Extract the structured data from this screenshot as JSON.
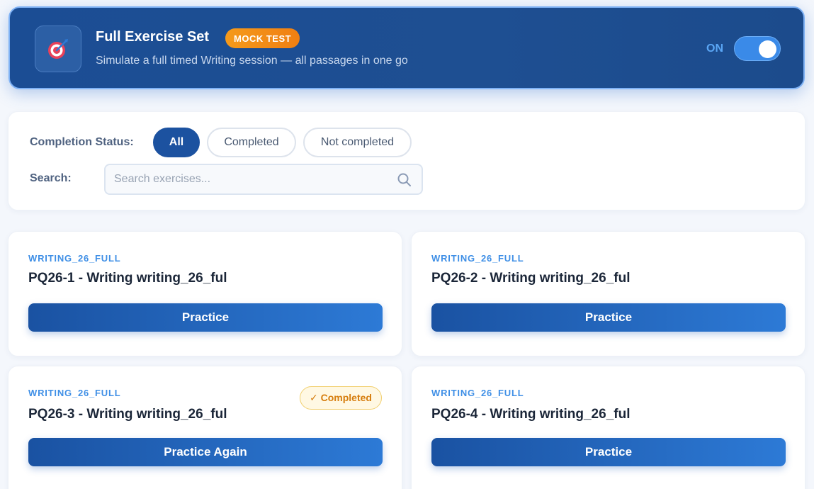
{
  "header": {
    "icon": "target-dart-icon",
    "title": "Full Exercise Set",
    "badge": "MOCK TEST",
    "subtitle": "Simulate a full timed Writing session — all passages in one go",
    "toggle_label": "ON",
    "toggle_on": true
  },
  "filters": {
    "status_label": "Completion Status:",
    "options": [
      "All",
      "Completed",
      "Not completed"
    ],
    "selected": "All",
    "search_label": "Search:",
    "search_placeholder": "Search exercises...",
    "search_value": ""
  },
  "cards": [
    {
      "tag": "WRITING_26_FULL",
      "title": "PQ26-1 - Writing writing_26_ful",
      "button": "Practice",
      "status": ""
    },
    {
      "tag": "WRITING_26_FULL",
      "title": "PQ26-2 - Writing writing_26_ful",
      "button": "Practice",
      "status": ""
    },
    {
      "tag": "WRITING_26_FULL",
      "title": "PQ26-3 - Writing writing_26_ful",
      "button": "Practice Again",
      "status": "✓ Completed"
    },
    {
      "tag": "WRITING_26_FULL",
      "title": "PQ26-4 - Writing writing_26_ful",
      "button": "Practice",
      "status": ""
    }
  ],
  "colors": {
    "brand": "#1c52a0",
    "accent": "#3f8fe6",
    "badge_orange": "#f28a16",
    "completed": "#d67d0d"
  }
}
